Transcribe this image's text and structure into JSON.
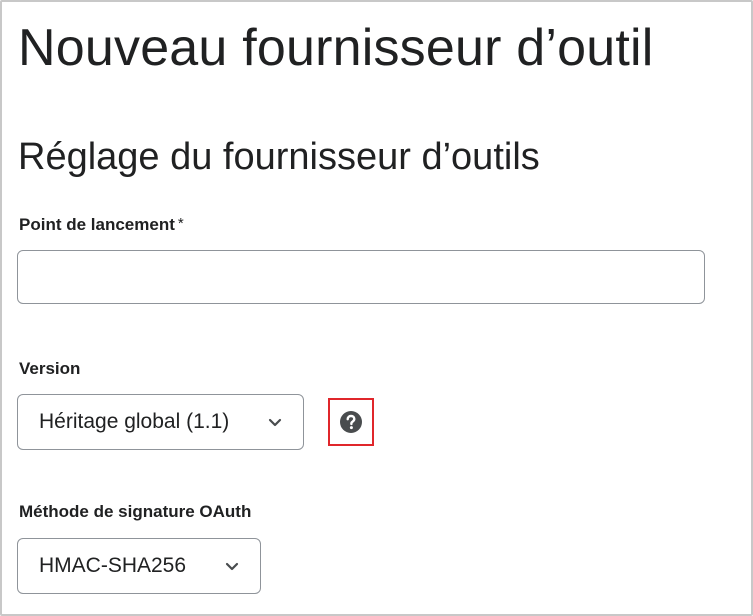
{
  "page": {
    "title": "Nouveau fournisseur d’outil"
  },
  "section": {
    "title": "Réglage du fournisseur d’outils"
  },
  "launch_point": {
    "label": "Point de lancement",
    "required_marker": "*",
    "value": "",
    "placeholder": ""
  },
  "version": {
    "label": "Version",
    "selected": "Héritage global (1.1)",
    "help_icon": "question-circle-icon",
    "help_highlight_color": "#e0262b"
  },
  "oauth": {
    "label": "Méthode de signature OAuth",
    "selected": "HMAC-SHA256"
  },
  "icons": {
    "dropdown": "chevron-down-icon"
  }
}
